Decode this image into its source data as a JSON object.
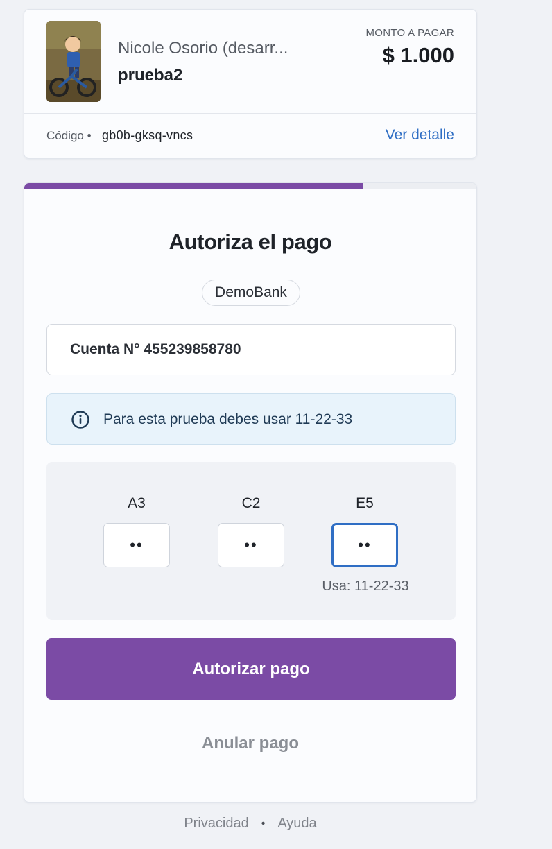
{
  "merchant": {
    "name": "Nicole Osorio (desarr...",
    "description": "prueba2",
    "amount_label": "MONTO A PAGAR",
    "amount": "$ 1.000",
    "code_label": "Código •",
    "code": "gb0b-gksq-vncs",
    "detail_link": "Ver detalle"
  },
  "auth": {
    "progress_percent": 75,
    "title": "Autoriza el pago",
    "bank": "DemoBank",
    "account": "Cuenta N° 455239858780",
    "info": "Para esta prueba debes usar 11-22-33",
    "coordinates": [
      {
        "label": "A3",
        "value": "••"
      },
      {
        "label": "C2",
        "value": "••"
      },
      {
        "label": "E5",
        "value": "••"
      }
    ],
    "hint": "Usa: 11-22-33",
    "authorize_label": "Autorizar pago",
    "cancel_label": "Anular pago"
  },
  "footer": {
    "privacy": "Privacidad",
    "separator": "•",
    "help": "Ayuda"
  },
  "colors": {
    "accent": "#7b4ba5",
    "link": "#2f6ec4",
    "info_bg": "#e8f3fb"
  }
}
